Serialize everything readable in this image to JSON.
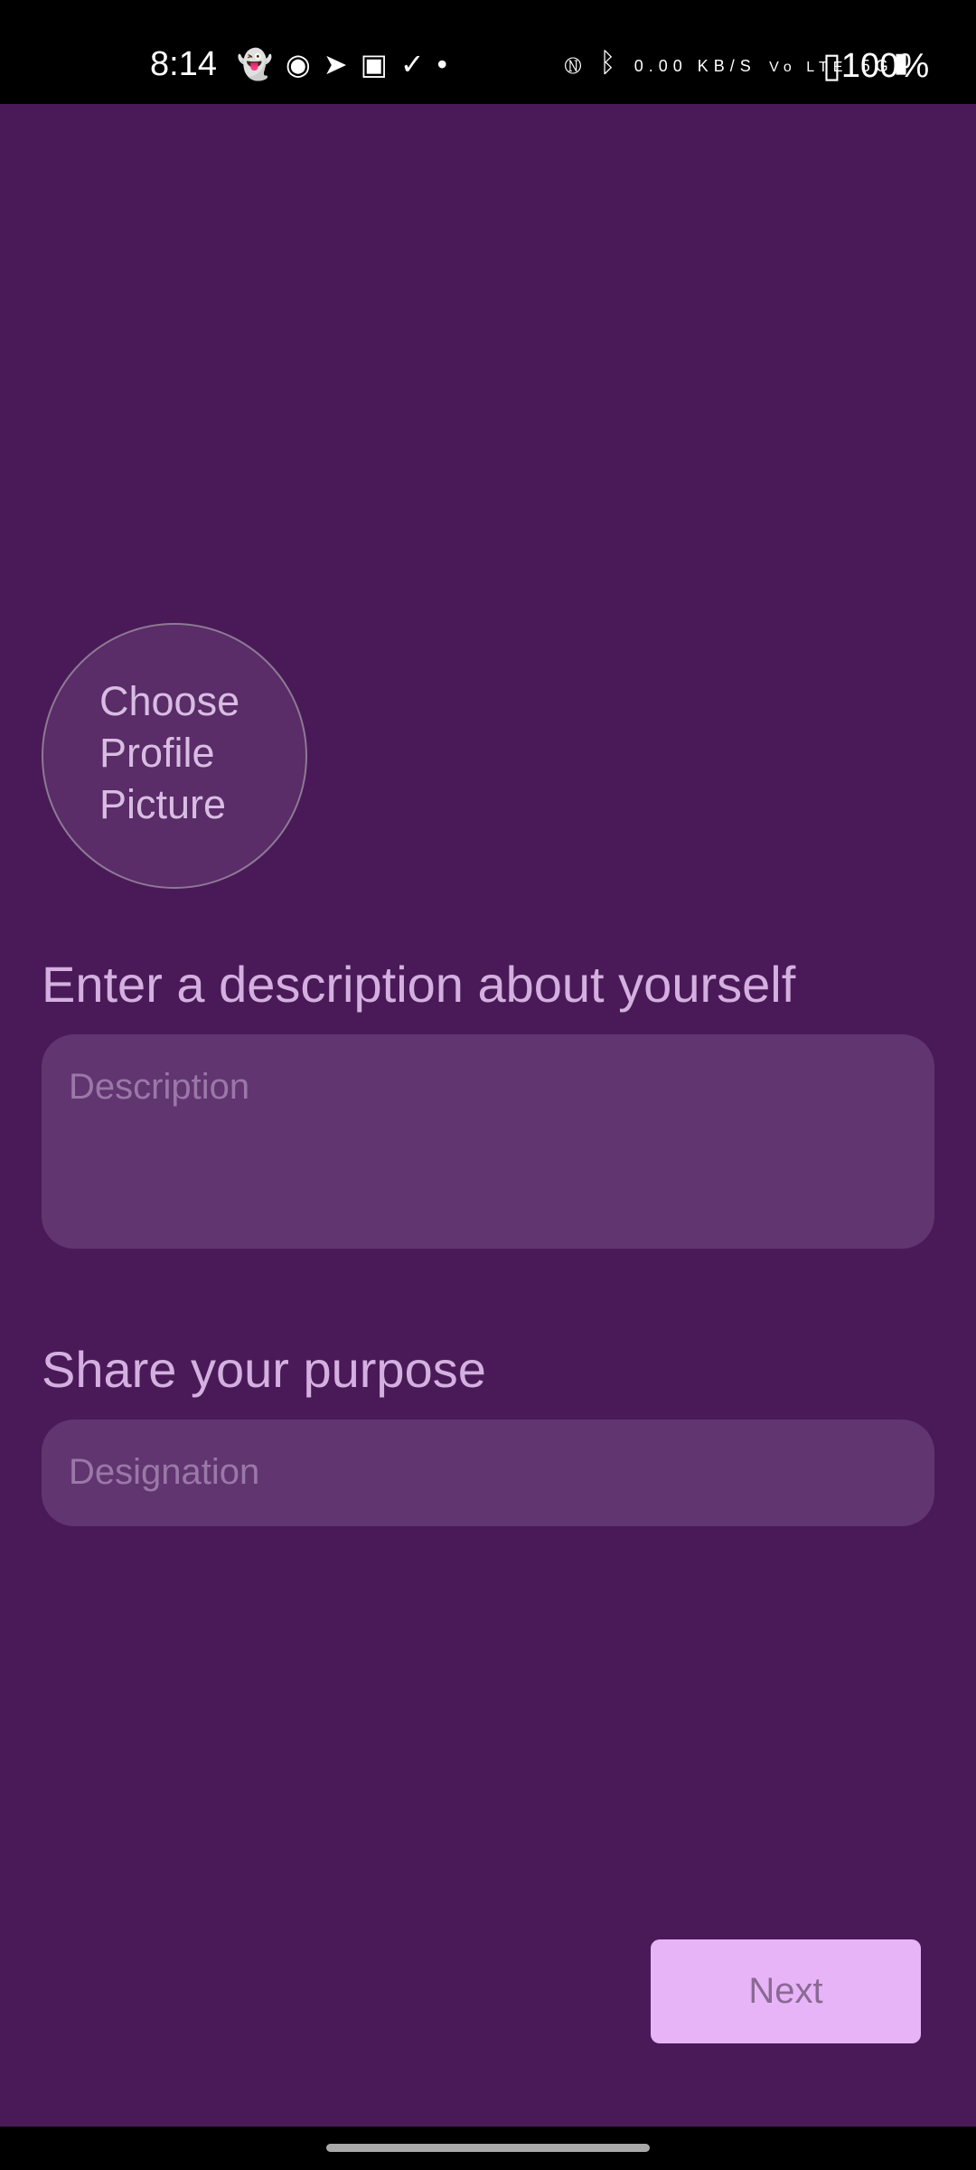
{
  "status_bar": {
    "time": "8:14",
    "left_icons": [
      "snapchat-icon",
      "discord-icon",
      "telegram-icon",
      "media-icon",
      "check-circle-icon",
      "dot-icon"
    ],
    "network_speed": "0.00 KB/S",
    "volte": "Vo LTE",
    "network": "5G",
    "battery": "100%"
  },
  "profile_picture": {
    "label": "Choose Profile Picture"
  },
  "description": {
    "label": "Enter a description about yourself",
    "placeholder": "Description",
    "value": ""
  },
  "purpose": {
    "label": "Share your purpose",
    "placeholder": "Designation",
    "value": ""
  },
  "next_button": {
    "label": "Next"
  },
  "colors": {
    "background": "#4a1a58",
    "field": "#613570",
    "button": "#e8b4f8",
    "label": "#d4b0e0"
  }
}
